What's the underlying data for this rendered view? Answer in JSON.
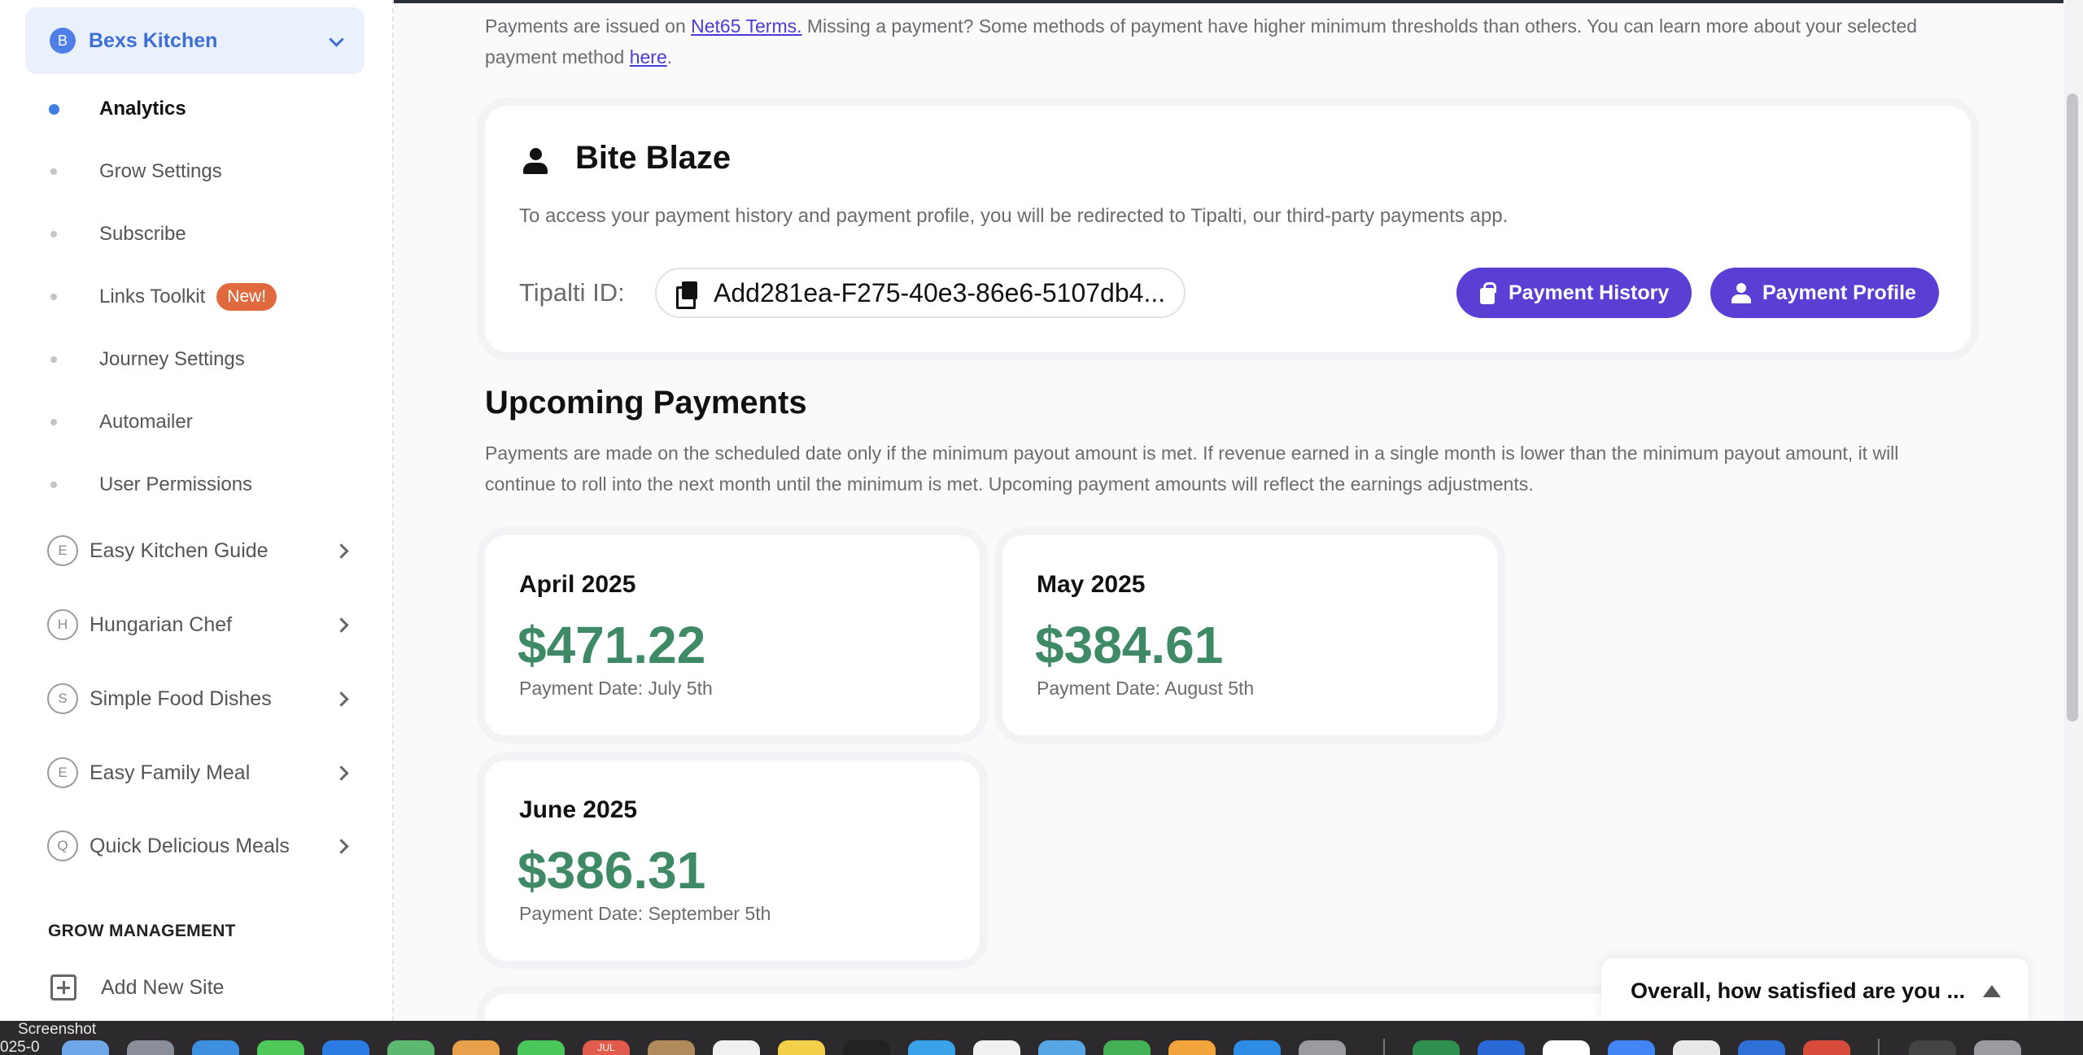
{
  "sidebar": {
    "site": {
      "initial": "B",
      "name": "Bexs Kitchen"
    },
    "nav": [
      {
        "label": "Analytics",
        "active": true
      },
      {
        "label": "Grow Settings"
      },
      {
        "label": "Subscribe"
      },
      {
        "label": "Links Toolkit",
        "badge": "New!"
      },
      {
        "label": "Journey Settings"
      },
      {
        "label": "Automailer"
      },
      {
        "label": "User Permissions"
      }
    ],
    "sites": [
      {
        "initial": "E",
        "name": "Easy Kitchen Guide"
      },
      {
        "initial": "H",
        "name": "Hungarian Chef"
      },
      {
        "initial": "S",
        "name": "Simple Food Dishes"
      },
      {
        "initial": "E",
        "name": "Easy Family Meal"
      },
      {
        "initial": "Q",
        "name": "Quick Delicious Meals"
      }
    ],
    "section_heading": "GROW MANAGEMENT",
    "add_site": "Add New Site"
  },
  "notice": {
    "prefix": "Payments are issued on ",
    "terms_link": "Net65 Terms.",
    "middle": " Missing a payment? Some methods of payment have higher minimum thresholds than others. You can learn more about your selected payment method ",
    "here_link": "here",
    "suffix": "."
  },
  "account": {
    "name": "Bite Blaze",
    "description": "To access your payment history and payment profile, you will be redirected to Tipalti, our third-party payments app.",
    "tipalti_label": "Tipalti ID:",
    "tipalti_id": "Add281ea-F275-40e3-86e6-5107db4...",
    "payment_history_label": "Payment History",
    "payment_profile_label": "Payment Profile"
  },
  "upcoming": {
    "title": "Upcoming Payments",
    "description": "Payments are made on the scheduled date only if the minimum payout amount is met. If revenue earned in a single month is lower than the minimum payout amount, it will continue to roll into the next month until the minimum is met. Upcoming payment amounts will reflect the earnings adjustments.",
    "payments": [
      {
        "month": "April 2025",
        "amount": "$471.22",
        "date": "Payment Date: July 5th"
      },
      {
        "month": "May 2025",
        "amount": "$384.61",
        "date": "Payment Date: August 5th"
      },
      {
        "month": "June 2025",
        "amount": "$386.31",
        "date": "Payment Date: September 5th"
      }
    ]
  },
  "survey": {
    "text": "Overall, how satisfied are you ..."
  },
  "dock": {
    "label_top": "Screenshot",
    "label_bottom": "025-0",
    "calendar_month": "JUL"
  },
  "colors": {
    "accent": "#5b3fd4",
    "sidebar_active": "#3f7de8",
    "amount": "#3f8a66",
    "new_badge": "#e06a3e"
  }
}
